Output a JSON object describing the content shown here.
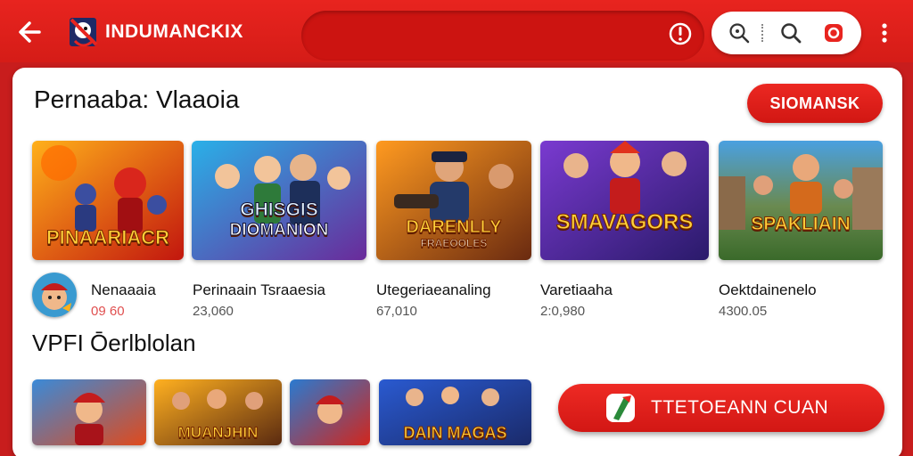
{
  "header": {
    "app_title": "INDUMANCKIX",
    "icons": [
      "back-arrow-icon",
      "logo-icon",
      "alert-icon",
      "zoom-icon",
      "search-icon",
      "record-icon",
      "more-vertical-icon"
    ]
  },
  "section": {
    "title": "Pernaaba: Vlaaoia",
    "subscribe_label": "SIOMANSK"
  },
  "videos": [
    {
      "thumb_text": "PINAARIACR",
      "thumb_sub": "",
      "title": "Nenaaaia",
      "meta": "09 60"
    },
    {
      "thumb_text": "GHISGIS",
      "thumb_sub": "DIOMANION",
      "title": "Perinaain Tsraaesia",
      "meta": "23,060"
    },
    {
      "thumb_text": "DARENLLY",
      "thumb_sub": "FRAEOOLES",
      "title": "Utegeriaeanaling",
      "meta": "67,010"
    },
    {
      "thumb_text": "SMAVAGORS",
      "thumb_sub": "",
      "title": "Varetiaaha",
      "meta": "2:0,980"
    },
    {
      "thumb_text": "SPAKLIAIN",
      "thumb_sub": "",
      "title": "Oektdainenelo",
      "meta": "4300.05"
    }
  ],
  "section2": {
    "title": "VPFI Ōerlblolan"
  },
  "row2_thumbs": [
    {
      "thumb_text": ""
    },
    {
      "thumb_text": "MUANJHIN"
    },
    {
      "thumb_text": ""
    },
    {
      "thumb_text": "DAIN MAGAS"
    }
  ],
  "cta": {
    "label": "TTETOEANN CUAN"
  },
  "colors": {
    "brand_red": "#e8241f",
    "card_bg": "#ffffff",
    "thumb_title": "#ffd23a"
  }
}
